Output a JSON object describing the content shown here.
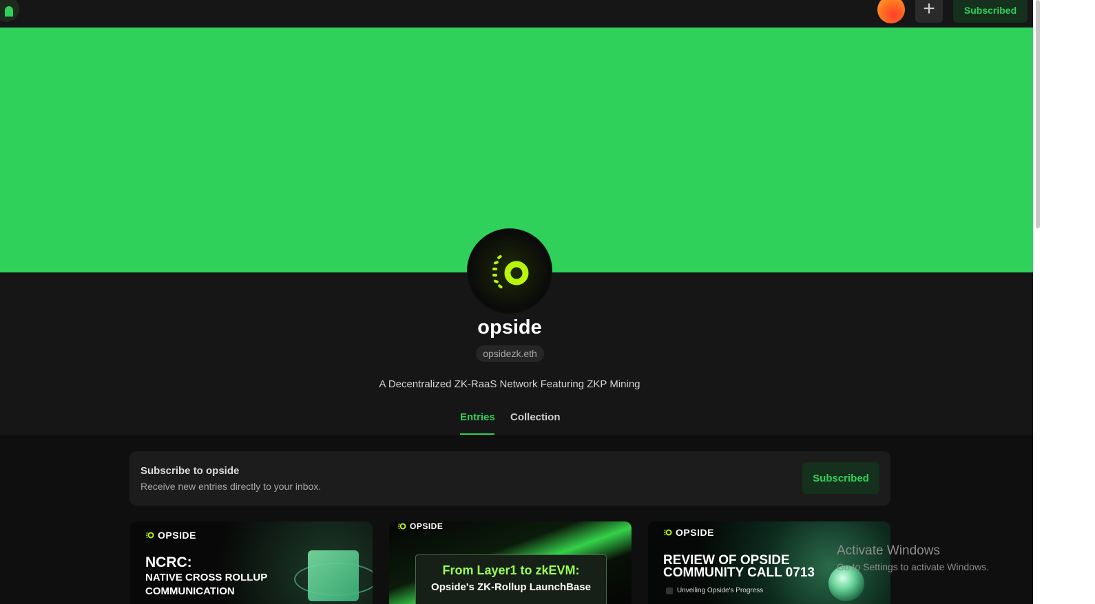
{
  "topbar": {
    "subscribed_label": "Subscribed",
    "plus_label": "+",
    "icons": {
      "logo": "mirror-logo-icon",
      "avatar": "user-avatar",
      "plus": "plus-icon"
    }
  },
  "colors": {
    "cover": "#30d15b",
    "accent": "#2fd15a",
    "button_bg": "#15301c",
    "page_bg": "#0f0f0f"
  },
  "profile": {
    "name": "opside",
    "handle": "opsidezk.eth",
    "description": "A Decentralized ZK-RaaS Network Featuring ZKP Mining"
  },
  "tabs": [
    {
      "label": "Entries",
      "active": true
    },
    {
      "label": "Collection",
      "active": false
    }
  ],
  "subscribe": {
    "title": "Subscribe to opside",
    "text": "Receive new entries directly to your inbox.",
    "button": "Subscribed"
  },
  "entries": [
    {
      "brand": "OPSIDE",
      "title": "NCRC:",
      "subtitle": "NATIVE CROSS ROLLUP COMMUNICATION"
    },
    {
      "brand": "OPSIDE",
      "title": "From Layer1 to zkEVM:",
      "subtitle": "Opside's ZK-Rollup LaunchBase"
    },
    {
      "brand": "OPSIDE",
      "title": "REVIEW OF OPSIDE COMMUNITY CALL 0713",
      "subtitle": "Unveiling Opside's Progress"
    }
  ],
  "watermark": {
    "line1": "Activate Windows",
    "line2": "Go to Settings to activate Windows."
  }
}
